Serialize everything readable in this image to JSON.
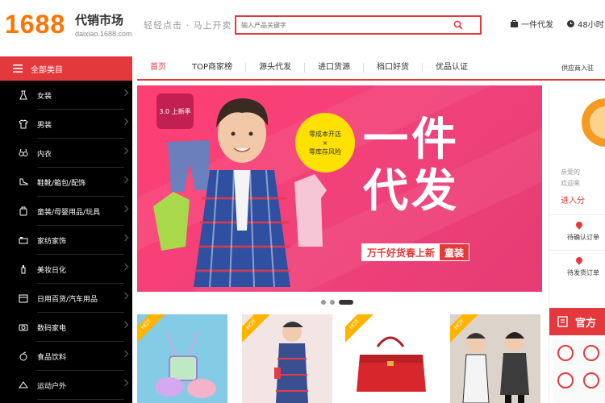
{
  "header": {
    "logo": "1688",
    "brand_title": "代销市场",
    "brand_sub": "daixiao.1688.com",
    "slogan": "轻轻点击 · 马上开卖",
    "search_placeholder": "输入产品关键字",
    "links": [
      "一件代发",
      "48小时"
    ]
  },
  "sidebar": {
    "header": "全部类目",
    "items": [
      {
        "label": "女装",
        "icon": "dress-icon"
      },
      {
        "label": "男装",
        "icon": "shirt-icon"
      },
      {
        "label": "内衣",
        "icon": "underwear-icon"
      },
      {
        "label": "鞋靴/箱包/配饰",
        "icon": "shoe-icon"
      },
      {
        "label": "童装/母婴用品/玩具",
        "icon": "baby-icon"
      },
      {
        "label": "家纺家饰",
        "icon": "home-textile-icon"
      },
      {
        "label": "美妆日化",
        "icon": "cosmetics-icon"
      },
      {
        "label": "日用百货/汽车用品",
        "icon": "daily-goods-icon"
      },
      {
        "label": "数码家电",
        "icon": "camera-icon"
      },
      {
        "label": "食品饮料",
        "icon": "food-icon"
      },
      {
        "label": "运动户外",
        "icon": "sports-icon"
      }
    ]
  },
  "nav": {
    "tabs": [
      "首页",
      "TOP商家榜",
      "源头代发",
      "进口货源",
      "档口好货",
      "优品认证"
    ],
    "active": 0,
    "right": "供应商入驻"
  },
  "banner": {
    "badge": "3.0 上新季",
    "bubble": [
      "零成本开店",
      "×",
      "零库存风险"
    ],
    "big_line1": "一件",
    "big_line2": "代发",
    "tag_left": "万千好货春上新",
    "tag_right": "童装"
  },
  "carousel": {
    "count": 3,
    "active": 2
  },
  "tiles": [
    {
      "badge": "HOT",
      "color": "#7ec8e3",
      "icon": "kids-bag-icon"
    },
    {
      "badge": "HOT",
      "color": "#f3e3e3",
      "icon": "kid-plaid-shirt-icon"
    },
    {
      "badge": "HOT",
      "color": "#ffffff",
      "icon": "red-handbag-icon"
    },
    {
      "badge": "HOT",
      "color": "#d9d0c6",
      "icon": "kids-photo-icon"
    }
  ],
  "right_panel": {
    "welcome": "亲爱的",
    "welcome_sub": "欢迎来",
    "enter": "进入分",
    "rows": [
      "待确认订单",
      "待发货订单"
    ],
    "red_title": "官方"
  }
}
